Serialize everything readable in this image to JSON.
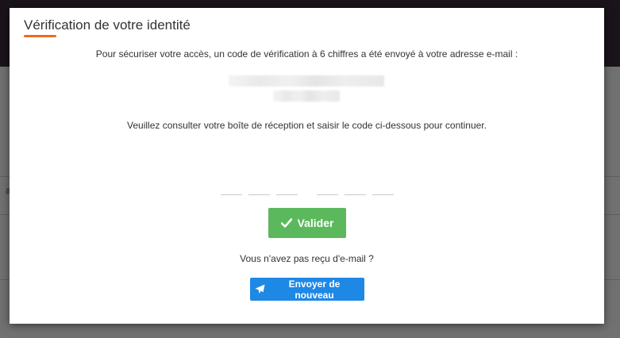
{
  "modal": {
    "title": "Vérification de votre identité",
    "intro_text": "Pour sécuriser votre accès, un code de vérification à 6 chiffres a été envoyé à votre adresse e-mail :",
    "instruction_text": "Veuillez consulter votre boîte de réception et saisir le code ci-dessous pour continuer.",
    "code_inputs": [
      "",
      "",
      "",
      "",
      "",
      ""
    ],
    "validate_label": "Valider",
    "no_email_text": "Vous n'avez pas reçu d'e-mail ?",
    "resend_label": "Envoyer de nouveau"
  },
  "background": {
    "fragments": [
      "a"
    ]
  },
  "colors": {
    "accent_underline": "#ee6a1f",
    "validate_button": "#5cb85c",
    "resend_button": "#1e88e5"
  },
  "icons": {
    "validate": "check-icon",
    "resend": "paper-plane-icon"
  }
}
